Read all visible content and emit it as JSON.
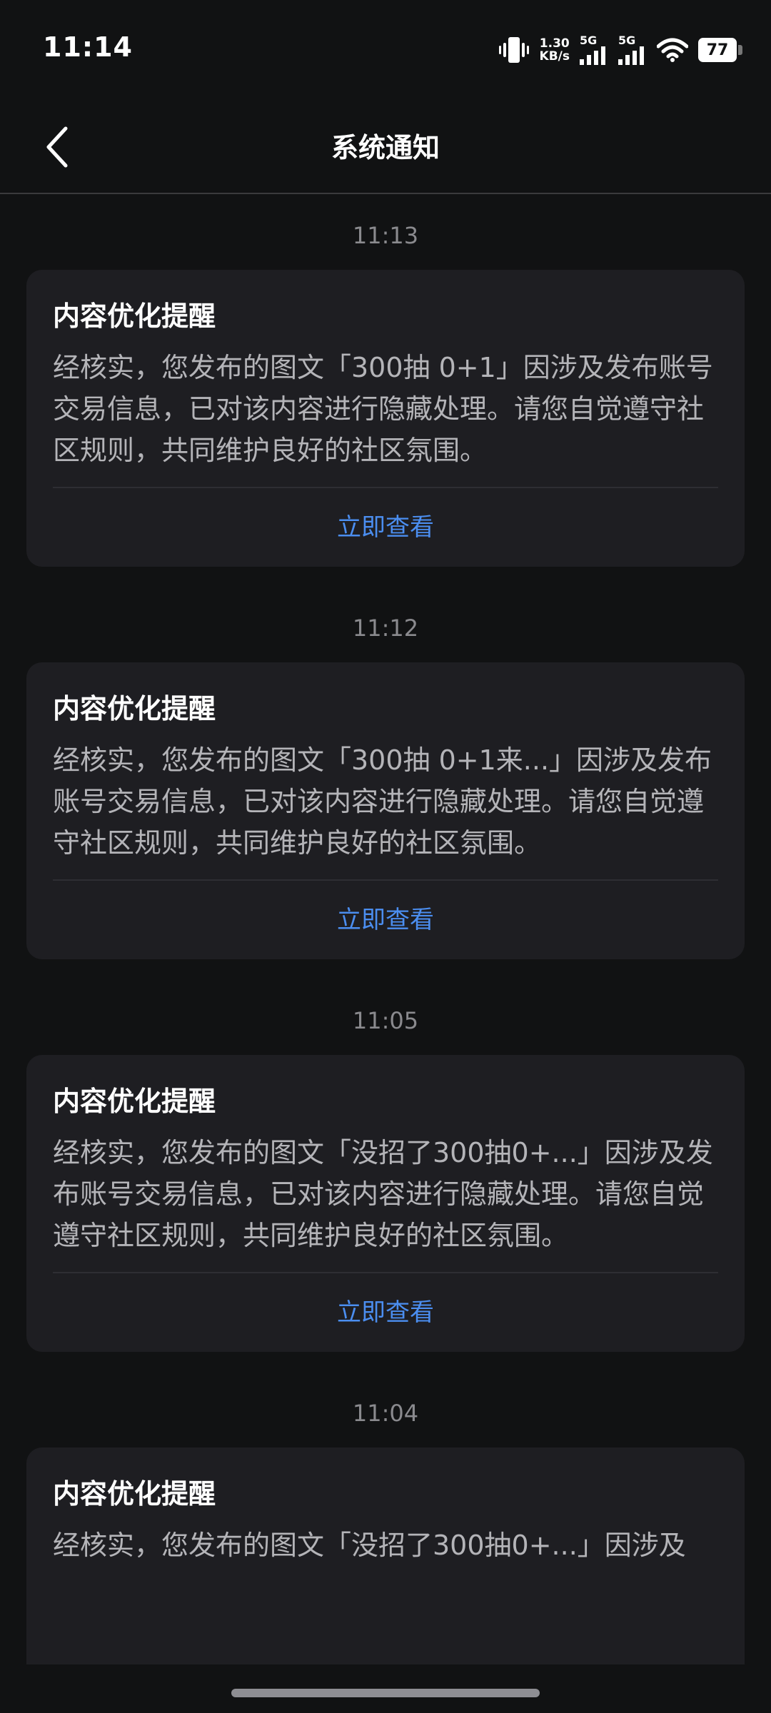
{
  "status_bar": {
    "time": "11:14",
    "net_speed_value": "1.30",
    "net_speed_unit": "KB/s",
    "signal1_label": "5G",
    "signal2_label": "5G",
    "battery": "77"
  },
  "header": {
    "title": "系统通知"
  },
  "notifications": [
    {
      "time": "11:13",
      "title": "内容优化提醒",
      "body": "经核实，您发布的图文「300抽 0+1」因涉及发布账号交易信息，已对该内容进行隐藏处理。请您自觉遵守社区规则，共同维护良好的社区氛围。",
      "action": "立即查看"
    },
    {
      "time": "11:12",
      "title": "内容优化提醒",
      "body": "经核实，您发布的图文「300抽 0+1来...」因涉及发布账号交易信息，已对该内容进行隐藏处理。请您自觉遵守社区规则，共同维护良好的社区氛围。",
      "action": "立即查看"
    },
    {
      "time": "11:05",
      "title": "内容优化提醒",
      "body": "经核实，您发布的图文「没招了300抽0+...」因涉及发布账号交易信息，已对该内容进行隐藏处理。请您自觉遵守社区规则，共同维护良好的社区氛围。",
      "action": "立即查看"
    },
    {
      "time": "11:04",
      "title": "内容优化提醒",
      "body": "经核实，您发布的图文「没招了300抽0+...」因涉及",
      "action": ""
    }
  ],
  "colors": {
    "background": "#111213",
    "card": "#1e1e22",
    "action": "#4b8ef0",
    "muted": "#8a8a8e"
  },
  "icons": {
    "back": "chevron-left-icon",
    "vibrate": "vibrate-icon",
    "signal": "signal-bars-icon",
    "wifi": "wifi-icon",
    "battery": "battery-icon"
  }
}
